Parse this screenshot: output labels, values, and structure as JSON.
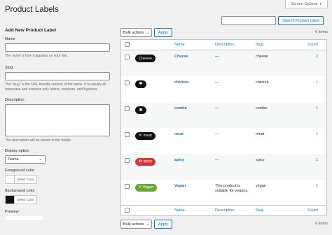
{
  "header": {
    "screen_options": "Screen Options",
    "title": "Product Labels",
    "search_button": "Search Product Label"
  },
  "form": {
    "heading": "Add New Product Label",
    "name_label": "Name",
    "name_desc": "The name is how it appears on your site.",
    "slug_label": "Slug",
    "slug_desc": "The “slug” is the URL-friendly version of the name. It is usually all lowercase and contains only letters, numbers, and hyphens.",
    "description_label": "Description",
    "description_desc": "The description will be shown in the tooltip",
    "display_label": "Display option",
    "display_value": "Name",
    "fg_label": "Foreground color",
    "fg_button": "Select Color",
    "fg_color": "#ffffff",
    "bg_label": "Background color",
    "bg_button": "Select Color",
    "bg_color": "#111111",
    "preview_label": "Preview"
  },
  "tablenav": {
    "bulk_label": "Bulk actions",
    "apply": "Apply",
    "items_count": "6 items"
  },
  "columns": {
    "name": "Name",
    "description": "Description",
    "slug": "Slug",
    "count": "Count"
  },
  "rows": [
    {
      "badge_text": "Cheese",
      "badge_color": "#111111",
      "badge_icon": "",
      "name": "Cheese",
      "description": "—",
      "slug": "cheese",
      "count": "2"
    },
    {
      "badge_text": "",
      "badge_color": "#111111",
      "badge_icon": "pill-icon",
      "name": "chicken",
      "description": "—",
      "slug": "chicken",
      "count": "1"
    },
    {
      "badge_text": "",
      "badge_color": "#111111",
      "badge_icon": "package-icon",
      "name": "combo",
      "description": "—",
      "slug": "combo",
      "count": "1"
    },
    {
      "badge_text": "meat",
      "badge_color": "#111111",
      "badge_icon": "cutlery-icon",
      "name": "meat",
      "description": "—",
      "slug": "meat",
      "count": "1"
    },
    {
      "badge_text": "spicy",
      "badge_color": "#d63638",
      "badge_icon": "chili-icon",
      "name": "spicy",
      "description": "—",
      "slug": "spicy",
      "count": "1"
    },
    {
      "badge_text": "Vegan",
      "badge_color": "#6aa836",
      "badge_icon": "leaf-icon",
      "name": "Vegan",
      "description": "This product is suitable for vegans.",
      "slug": "vegan",
      "count": "1"
    }
  ]
}
